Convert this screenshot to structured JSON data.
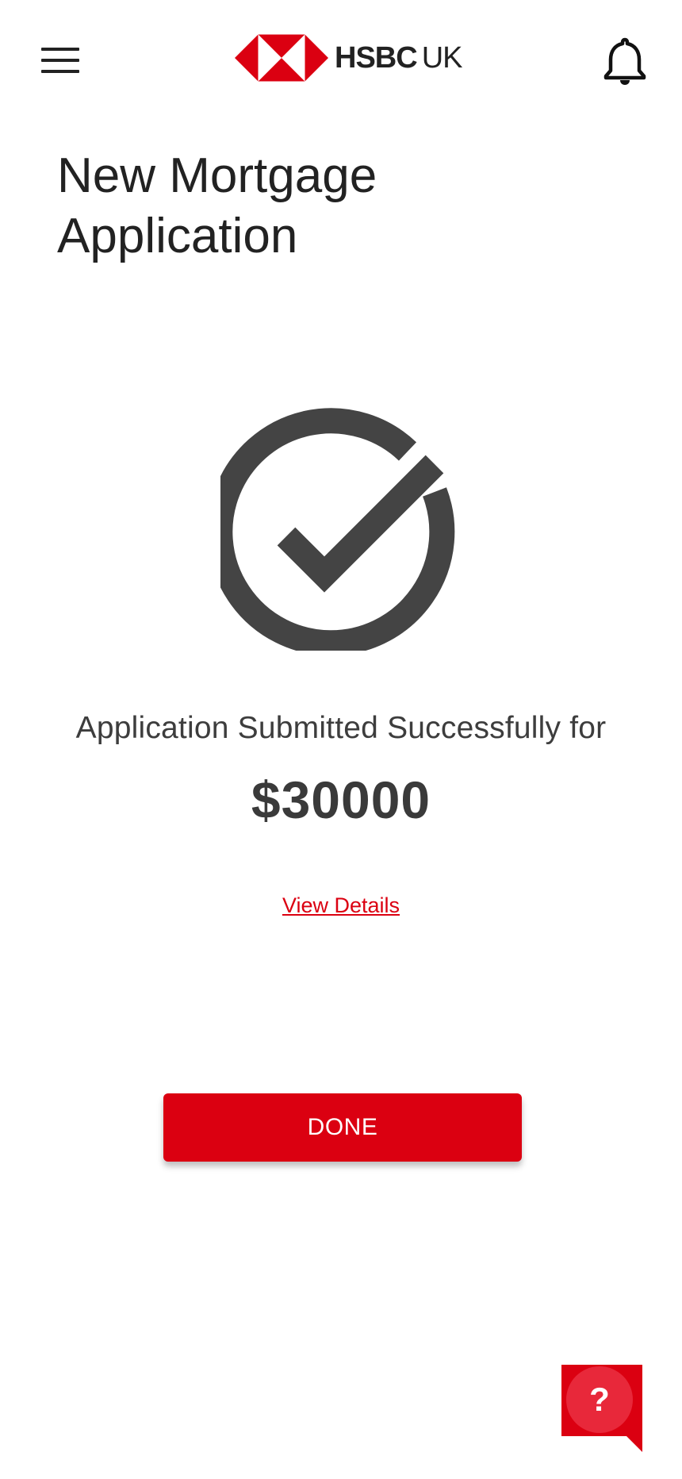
{
  "header": {
    "brand_name": "HSBC",
    "brand_region": "UK",
    "menu_icon": "hamburger-menu-icon",
    "notification_icon": "bell-icon"
  },
  "page": {
    "title": "New Mortgage Application"
  },
  "result": {
    "status_icon": "check-circle-icon",
    "message": "Application Submitted Successfully for",
    "amount": "$30000",
    "details_link": "View Details"
  },
  "actions": {
    "done_label": "DONE"
  },
  "help": {
    "label": "?",
    "icon": "help-chat-icon"
  },
  "colors": {
    "brand_red": "#db0011",
    "icon_gray": "#444444",
    "text_dark": "#222222"
  }
}
